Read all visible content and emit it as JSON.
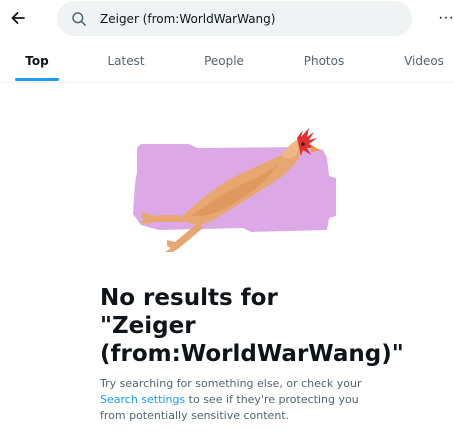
{
  "search": {
    "query": "Zeiger (from:WorldWarWang)"
  },
  "icons": {
    "back": "arrow-left-icon",
    "search": "search-icon",
    "more": "more-icon"
  },
  "tabs": [
    {
      "label": "Top",
      "active": true
    },
    {
      "label": "Latest",
      "active": false
    },
    {
      "label": "People",
      "active": false
    },
    {
      "label": "Photos",
      "active": false
    },
    {
      "label": "Videos",
      "active": false
    }
  ],
  "empty_state": {
    "title": "No results for \"Zeiger (from:WorldWarWang)\"",
    "body_before": "Try searching for something else, or check your",
    "link": "Search settings",
    "body_after": "to see if they're protecting you from potentially sensitive content."
  },
  "colors": {
    "accent": "#1d9bf0",
    "search_bg": "#eff3f4",
    "illustration_bg": "#dca8e6",
    "text_primary": "#0f1419",
    "text_secondary": "#536471"
  }
}
